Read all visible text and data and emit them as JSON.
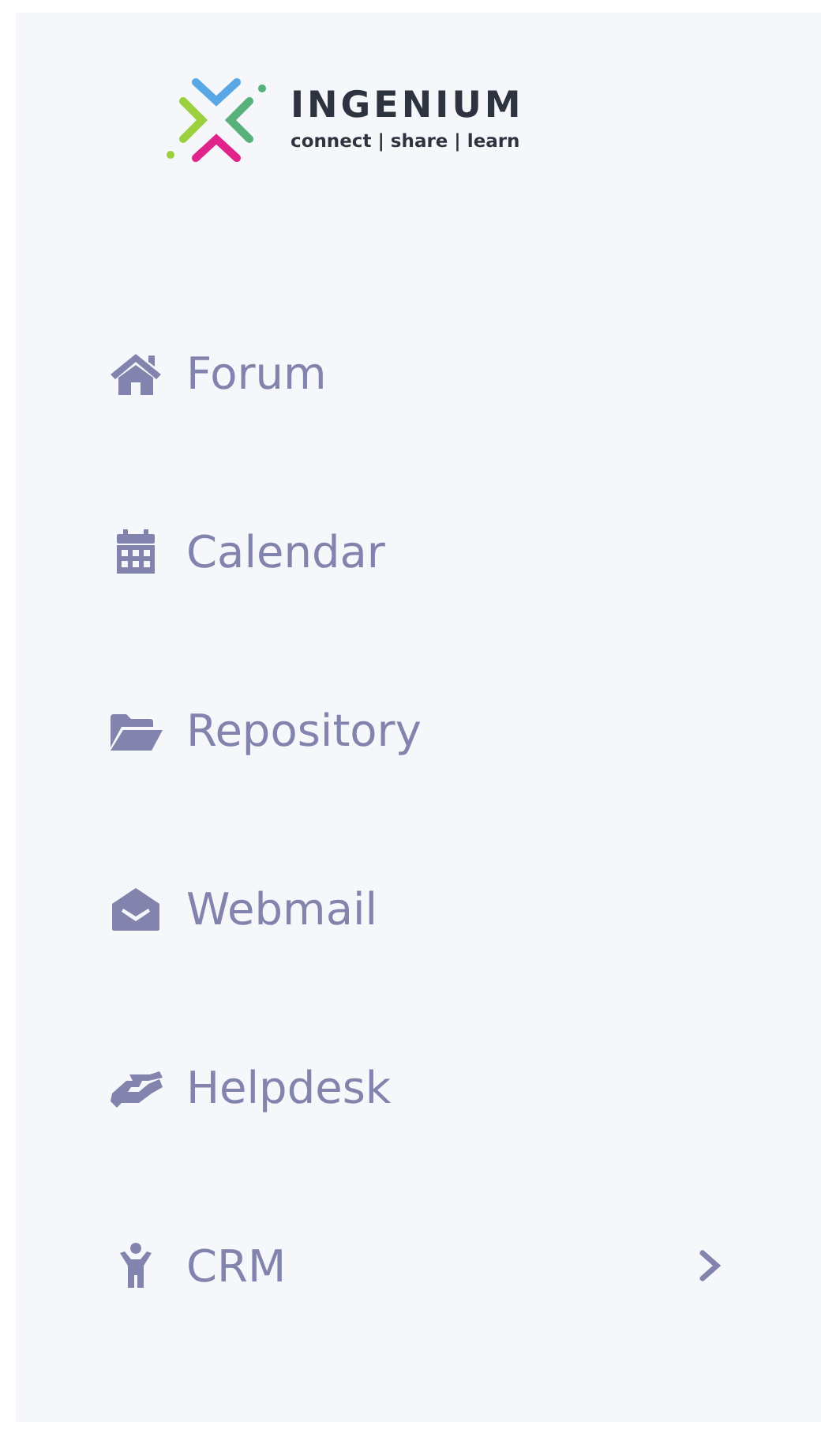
{
  "sidebar": {
    "logo": {
      "name": "INGENIUM",
      "tagline": "connect | share | learn"
    },
    "items": [
      {
        "label": "Forum",
        "has_submenu": false
      },
      {
        "label": "Calendar",
        "has_submenu": false
      },
      {
        "label": "Repository",
        "has_submenu": false
      },
      {
        "label": "Webmail",
        "has_submenu": false
      },
      {
        "label": "Helpdesk",
        "has_submenu": false
      },
      {
        "label": "CRM",
        "has_submenu": true
      }
    ]
  }
}
